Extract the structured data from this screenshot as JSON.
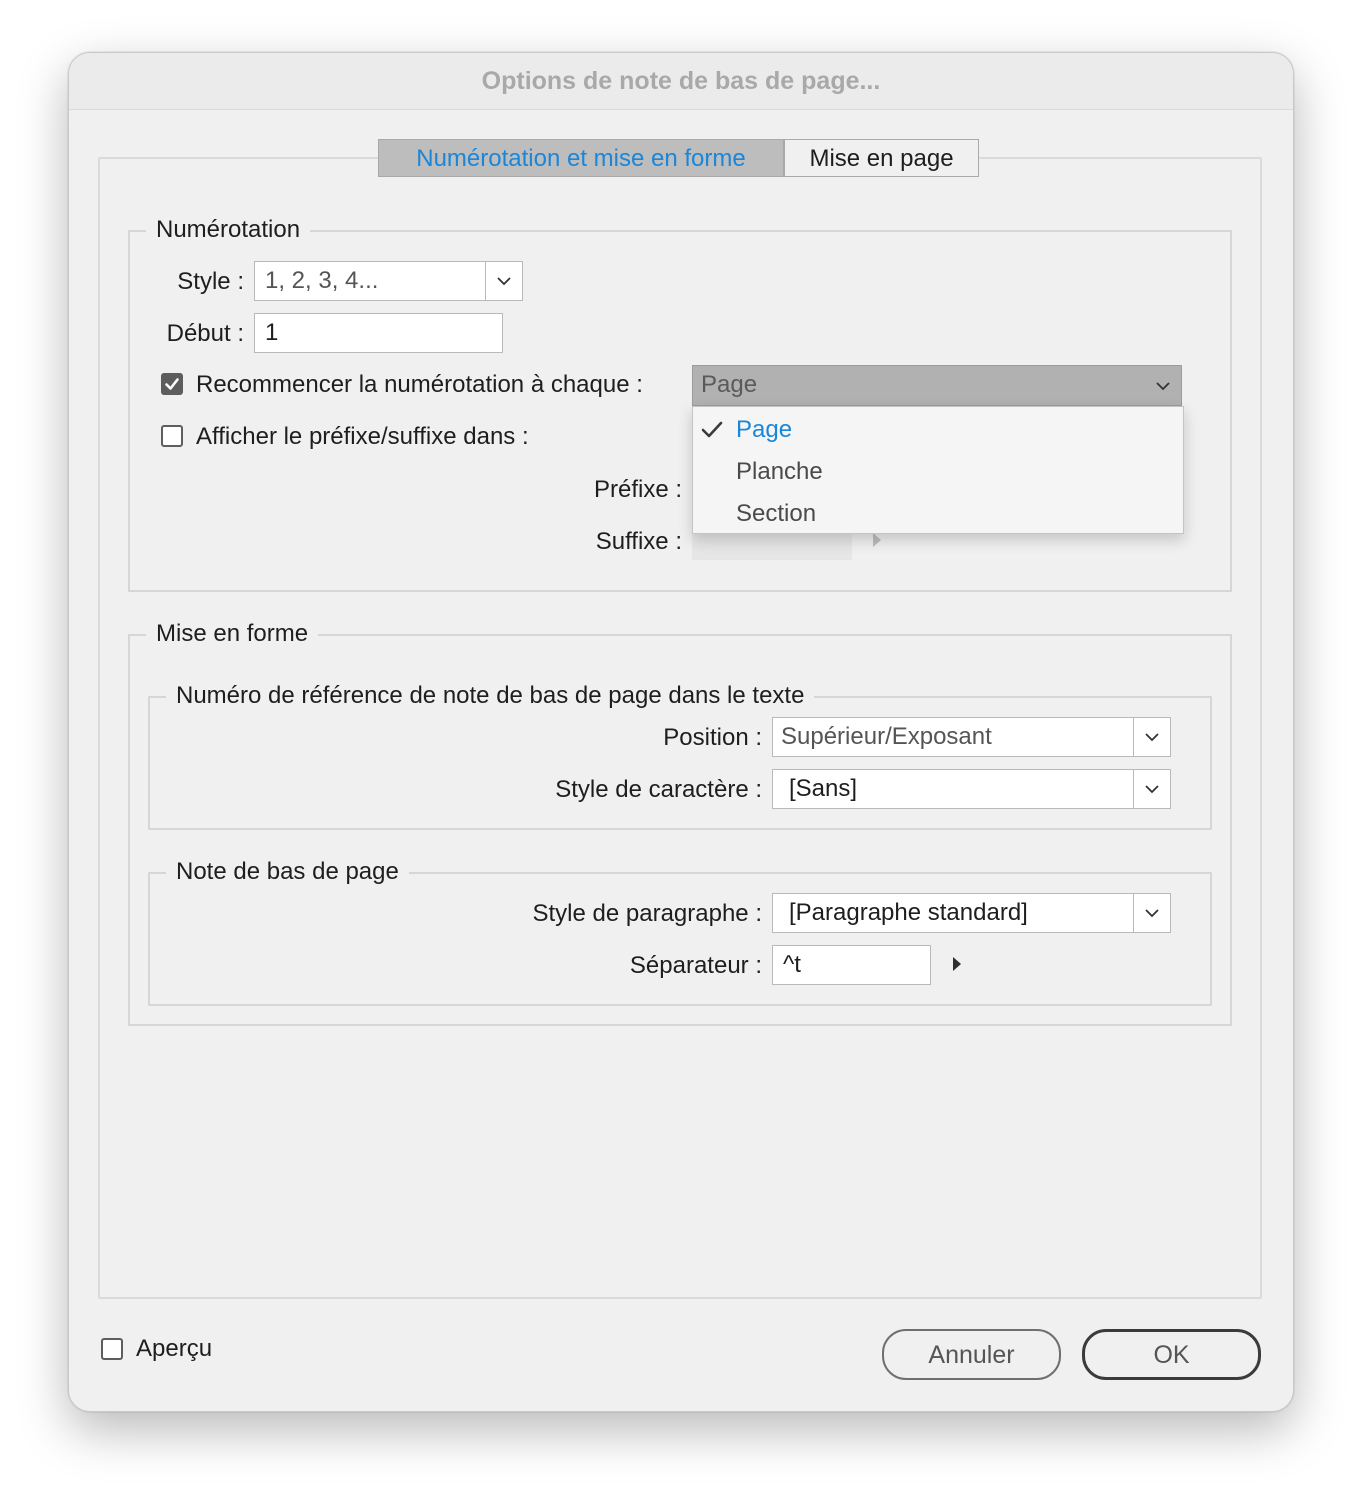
{
  "dialog": {
    "title": "Options de note de bas de page..."
  },
  "tabs": [
    {
      "label": "Numérotation et mise en forme",
      "active": true
    },
    {
      "label": "Mise en page",
      "active": false
    }
  ],
  "numbering": {
    "legend": "Numérotation",
    "style_label": "Style :",
    "style_value": "1, 2, 3, 4...",
    "start_label": "Début :",
    "start_value": "1",
    "restart_label": "Recommencer la numérotation à chaque :",
    "restart_checked": true,
    "restart_value": "Page",
    "restart_options": [
      "Page",
      "Planche",
      "Section"
    ],
    "restart_selected": "Page",
    "prefix_suffix_label": "Afficher le préfixe/suffixe dans :",
    "prefix_suffix_checked": false,
    "prefix_label": "Préfixe :",
    "suffix_label": "Suffixe :"
  },
  "formatting": {
    "legend": "Mise en forme",
    "reference": {
      "legend": "Numéro de référence de note de bas de page dans le texte",
      "position_label": "Position :",
      "position_value": "Supérieur/Exposant",
      "char_style_label": "Style de caractère :",
      "char_style_value": "[Sans]"
    },
    "footnote": {
      "legend": "Note de bas de page",
      "para_style_label": "Style de paragraphe :",
      "para_style_value": "[Paragraphe standard]",
      "separator_label": "Séparateur :",
      "separator_value": "^t"
    }
  },
  "footer": {
    "preview_label": "Aperçu",
    "preview_checked": false,
    "cancel_label": "Annuler",
    "ok_label": "OK"
  },
  "colors": {
    "accent": "#1b86d8",
    "active_tab_bg": "#bdbdbd",
    "dialog_bg": "#f0f0f0"
  }
}
